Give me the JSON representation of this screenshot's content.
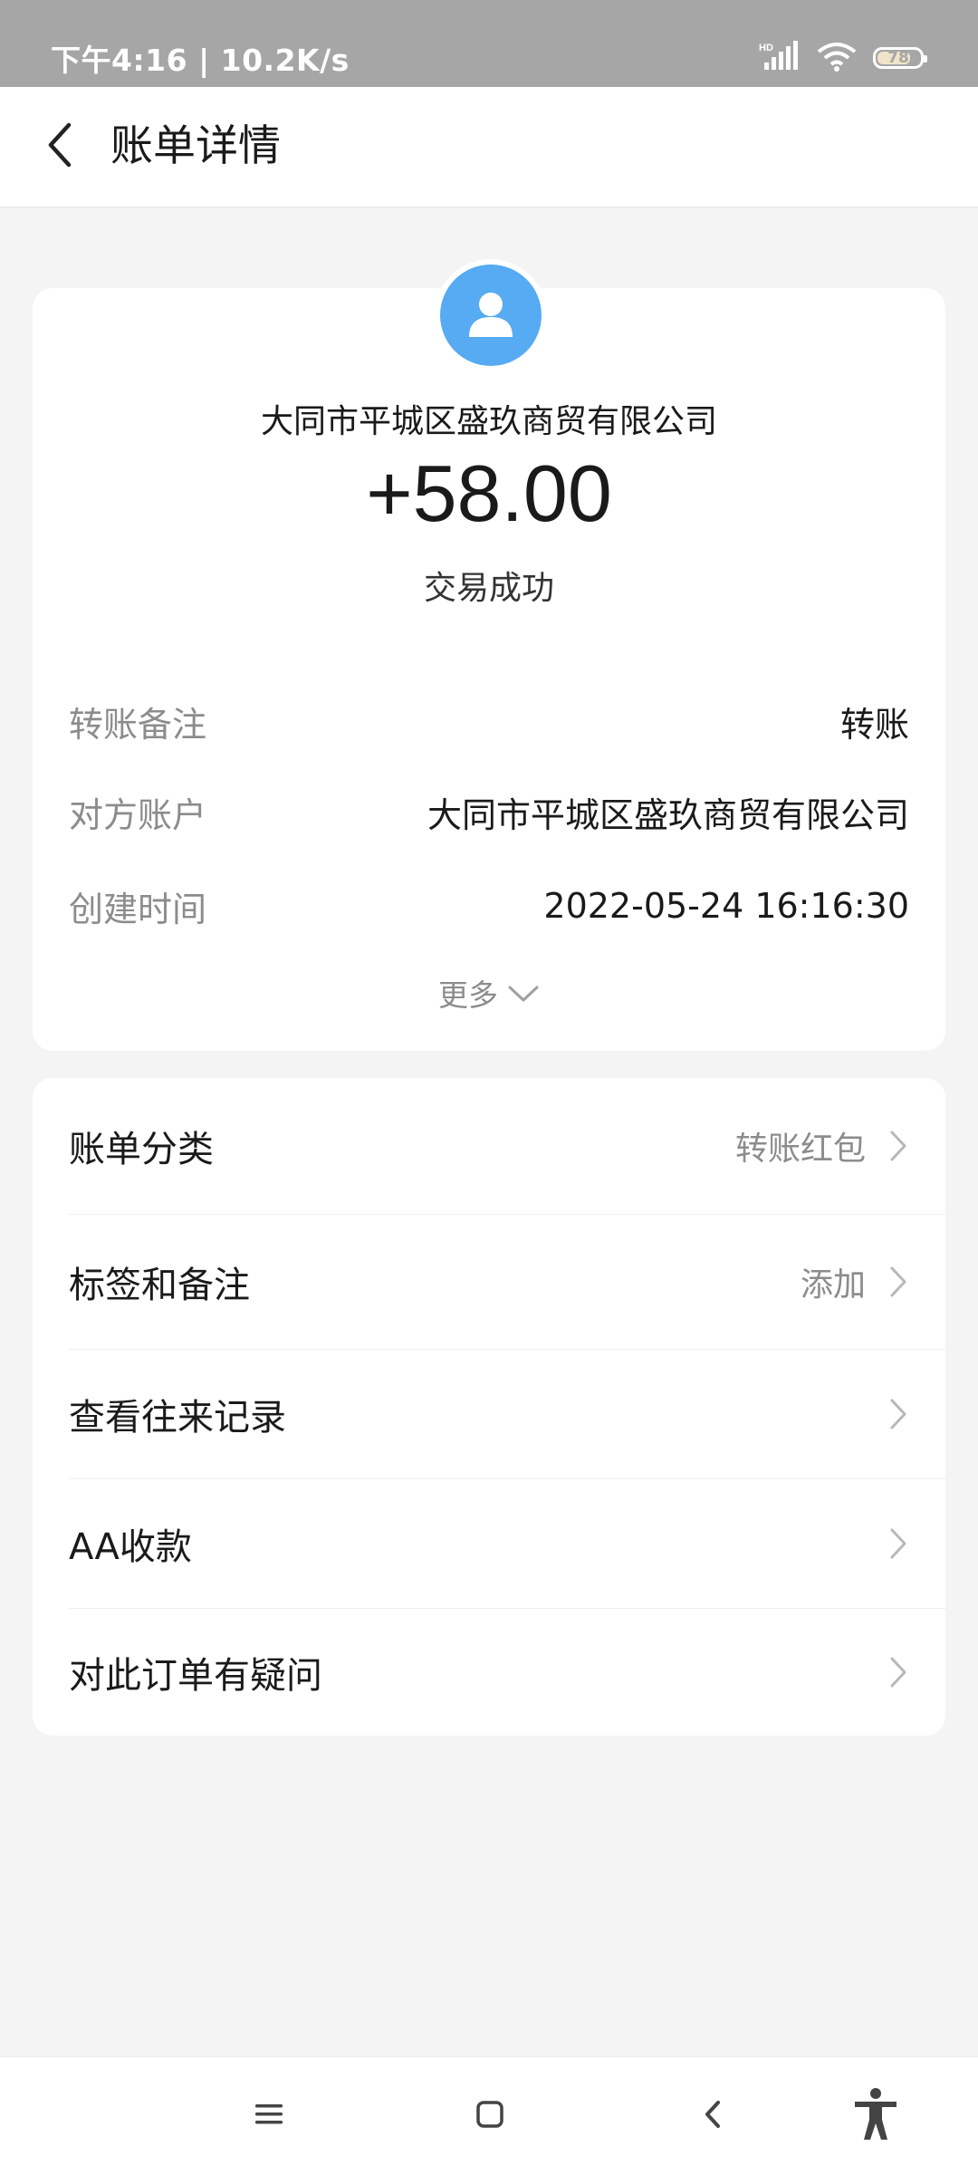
{
  "status_bar": {
    "time_speed": "下午4:16 | 10.2K/s",
    "battery_level": "78",
    "battery_fraction": 0.78,
    "icons": [
      "hd-signal-icon",
      "wifi-icon",
      "battery-icon"
    ]
  },
  "header": {
    "title": "账单详情",
    "back_icon": "chevron-left-icon"
  },
  "summary": {
    "avatar_icon": "user-icon",
    "merchant": "大同市平城区盛玖商贸有限公司",
    "amount": "+58.00",
    "status": "交易成功"
  },
  "details": [
    {
      "label": "转账备注",
      "value": "转账"
    },
    {
      "label": "对方账户",
      "value": "大同市平城区盛玖商贸有限公司"
    },
    {
      "label": "创建时间",
      "value": "2022-05-24 16:16:30"
    }
  ],
  "more_label": "更多",
  "actions": [
    {
      "label": "账单分类",
      "value": "转账红包"
    },
    {
      "label": "标签和备注",
      "value": "添加"
    },
    {
      "label": "查看往来记录",
      "value": ""
    },
    {
      "label": "AA收款",
      "value": ""
    },
    {
      "label": "对此订单有疑问",
      "value": ""
    }
  ],
  "bottom_nav": [
    "menu-icon",
    "home-icon",
    "back-icon",
    "accessibility-icon"
  ],
  "colors": {
    "accent_avatar": "#56abf2",
    "background": "#f4f4f5",
    "status_bar": "#a6a6a6"
  }
}
